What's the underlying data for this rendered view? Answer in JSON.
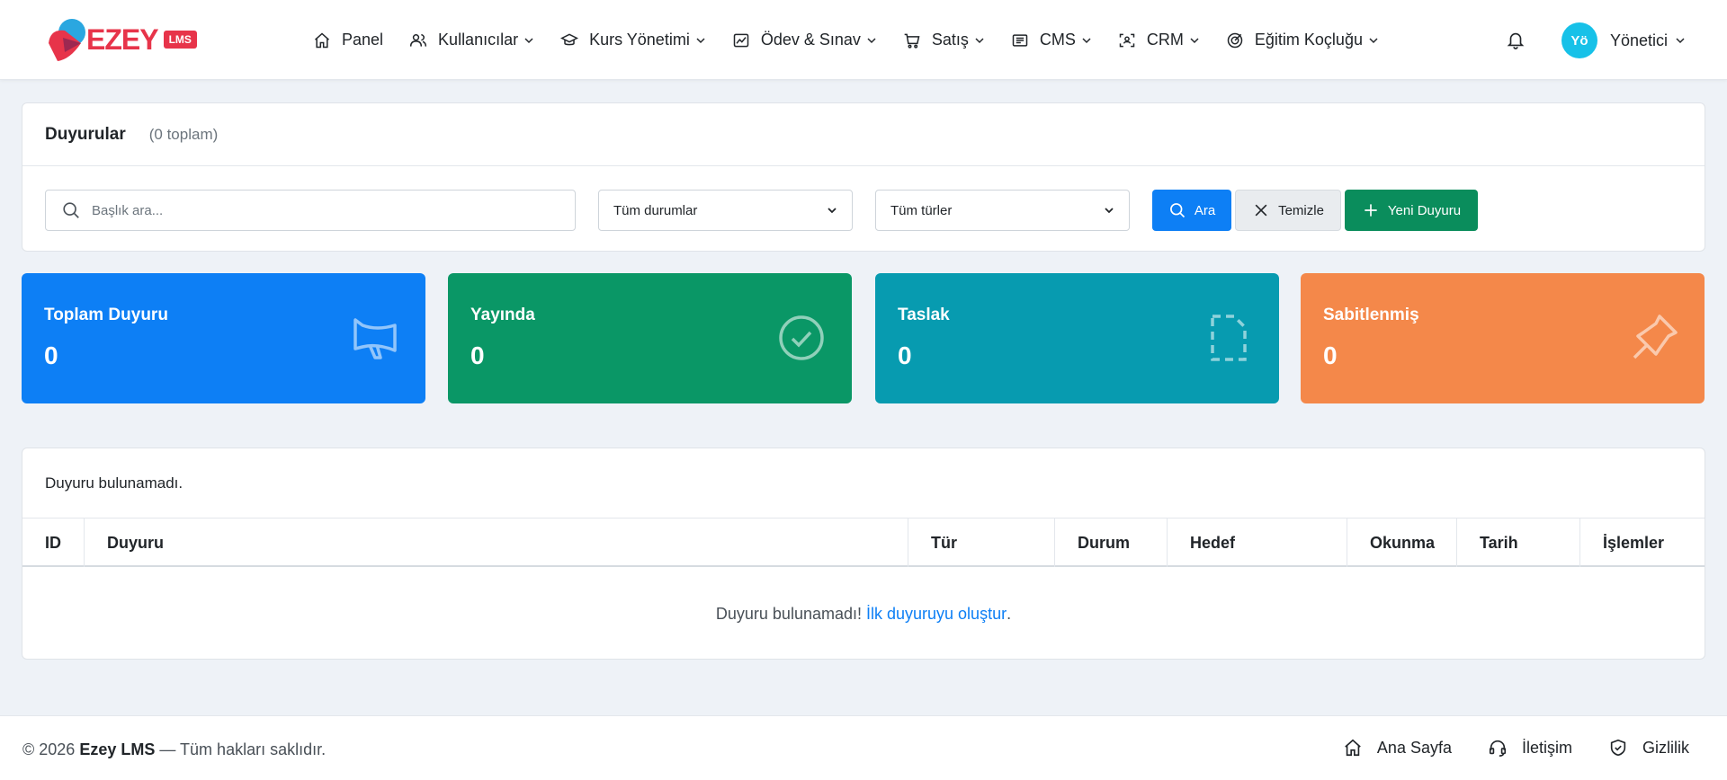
{
  "brand": {
    "name": "EZEY",
    "badge": "LMS",
    "primary_color": "#e7344a"
  },
  "nav": {
    "items": [
      {
        "label": "Panel",
        "icon": "home-icon",
        "dropdown": false
      },
      {
        "label": "Kullanıcılar",
        "icon": "users-icon",
        "dropdown": true
      },
      {
        "label": "Kurs Yönetimi",
        "icon": "graduation-cap-icon",
        "dropdown": true
      },
      {
        "label": "Ödev & Sınav",
        "icon": "image-chart-icon",
        "dropdown": true
      },
      {
        "label": "Satış",
        "icon": "cart-icon",
        "dropdown": true
      },
      {
        "label": "CMS",
        "icon": "newspaper-icon",
        "dropdown": true
      },
      {
        "label": "CRM",
        "icon": "user-scan-icon",
        "dropdown": true
      },
      {
        "label": "Eğitim Koçluğu",
        "icon": "target-icon",
        "dropdown": true
      }
    ],
    "notification_icon": "bell-icon",
    "user": {
      "avatar_text": "Yö",
      "name": "Yönetici",
      "avatar_color": "#17c1e8"
    }
  },
  "filter": {
    "title": "Duyurular",
    "count": "(0 toplam)",
    "search_placeholder": "Başlık ara...",
    "status_select": "Tüm durumlar",
    "type_select": "Tüm türler",
    "search_button": "Ara",
    "clear_button": "Temizle",
    "new_button": "Yeni Duyuru"
  },
  "stats": [
    {
      "label": "Toplam Duyuru",
      "value": "0",
      "color": "#0d7ff5",
      "icon": "megaphone-icon"
    },
    {
      "label": "Yayında",
      "value": "0",
      "color": "#0a9766",
      "icon": "check-circle-icon"
    },
    {
      "label": "Taslak",
      "value": "0",
      "color": "#079bb0",
      "icon": "dashed-file-icon"
    },
    {
      "label": "Sabitlenmiş",
      "value": "0",
      "color": "#f4884a",
      "icon": "pin-icon"
    }
  ],
  "table": {
    "header_message": "Duyuru bulunamadı.",
    "columns": [
      "ID",
      "Duyuru",
      "Tür",
      "Durum",
      "Hedef",
      "Okunma",
      "Tarih",
      "İşlemler"
    ],
    "empty_text": "Duyuru bulunamadı!",
    "empty_link": "İlk duyuruyu oluştur",
    "empty_suffix": "."
  },
  "footer": {
    "year": "© 2026",
    "brand": "Ezey LMS",
    "rights": "— Tüm hakları saklıdır.",
    "links": [
      {
        "label": "Ana Sayfa",
        "icon": "home-icon"
      },
      {
        "label": "İletişim",
        "icon": "headset-icon"
      },
      {
        "label": "Gizlilik",
        "icon": "shield-check-icon"
      }
    ]
  }
}
